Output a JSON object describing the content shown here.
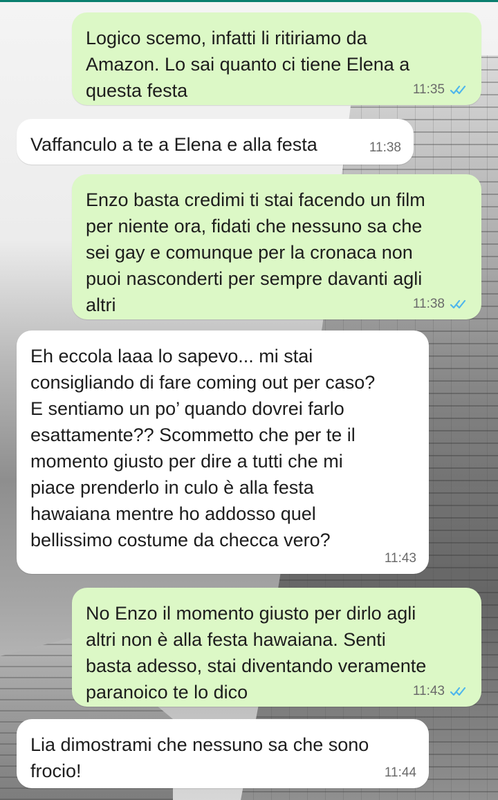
{
  "messages": [
    {
      "direction": "outgoing",
      "text": "Logico scemo, infatti li ritiriamo da\nAmazon. Lo sai quanto ci tiene Elena a\nquesta festa",
      "time": "11:35",
      "status": "read"
    },
    {
      "direction": "incoming",
      "text": "Vaffanculo a te a Elena e alla festa",
      "time": "11:38"
    },
    {
      "direction": "outgoing",
      "text": "Enzo basta credimi ti stai facendo un film\nper niente ora, fidati che nessuno sa che\nsei gay e comunque per la cronaca non\npuoi nasconderti per sempre davanti agli\naltri",
      "time": "11:38",
      "status": "read"
    },
    {
      "direction": "incoming",
      "text": "Eh eccola laaa lo sapevo... mi stai\nconsigliando di fare coming out per caso?\nE sentiamo un po’ quando dovrei farlo\nesattamente?? Scommetto che per te il\nmomento giusto per dire a tutti che mi\npiace prenderlo in culo è alla festa\nhawaiana mentre ho addosso quel\nbellissimo costume da checca vero?",
      "time": "11:43"
    },
    {
      "direction": "outgoing",
      "text": "No Enzo il momento giusto per dirlo agli\naltri non è alla festa hawaiana. Senti\nbasta adesso, stai diventando veramente\nparanoico te lo dico",
      "time": "11:43",
      "status": "read"
    },
    {
      "direction": "incoming",
      "text": "Lia dimostrami che nessuno sa che sono\nfrocio!",
      "time": "11:44"
    }
  ],
  "colors": {
    "outgoing_bubble": "#dcf8c6",
    "incoming_bubble": "#ffffff",
    "read_ticks": "#4fb6ec",
    "timestamp": "#6a6a6a",
    "top_line": "#0a7f6f"
  },
  "icons": {
    "read_receipt": "double-check-icon"
  }
}
